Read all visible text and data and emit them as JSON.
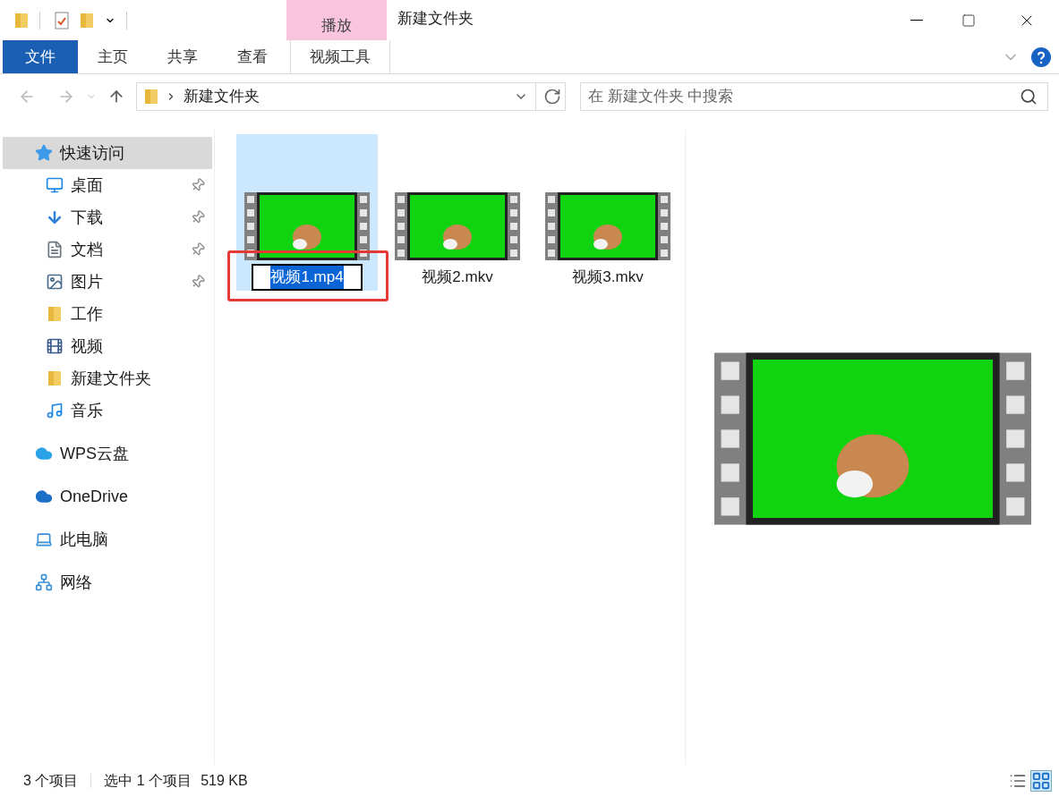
{
  "title_bar": {
    "contextual_tab": "播放",
    "title": "新建文件夹"
  },
  "ribbon_tabs": [
    {
      "label": "文件",
      "kind": "file"
    },
    {
      "label": "主页",
      "kind": "tab"
    },
    {
      "label": "共享",
      "kind": "tab"
    },
    {
      "label": "查看",
      "kind": "tab"
    },
    {
      "label": "视频工具",
      "kind": "contextual"
    }
  ],
  "address_bar": {
    "path": [
      "新建文件夹"
    ]
  },
  "search": {
    "placeholder": "在 新建文件夹 中搜索"
  },
  "sidebar": {
    "items": [
      {
        "label": "快速访问",
        "kind": "star",
        "selected": true,
        "children": [
          {
            "label": "桌面",
            "kind": "desktop",
            "pinned": true,
            "selected": false
          },
          {
            "label": "下载",
            "kind": "download",
            "pinned": true,
            "selected": false
          },
          {
            "label": "文档",
            "kind": "document",
            "pinned": true,
            "selected": false
          },
          {
            "label": "图片",
            "kind": "picture",
            "pinned": true,
            "selected": false
          },
          {
            "label": "工作",
            "kind": "folder",
            "pinned": false,
            "selected": false
          },
          {
            "label": "视频",
            "kind": "video",
            "pinned": false,
            "selected": false
          },
          {
            "label": "新建文件夹",
            "kind": "folder",
            "pinned": false,
            "selected": false
          },
          {
            "label": "音乐",
            "kind": "music",
            "pinned": false,
            "selected": false
          }
        ]
      },
      {
        "label": "WPS云盘",
        "kind": "cloud",
        "selected": false
      },
      {
        "label": "OneDrive",
        "kind": "onedrive",
        "selected": false
      },
      {
        "label": "此电脑",
        "kind": "pc",
        "selected": false
      },
      {
        "label": "网络",
        "kind": "network",
        "selected": false
      }
    ]
  },
  "files": [
    {
      "name": "视频1.mp4",
      "selected": true,
      "renaming": true,
      "highlighted": true
    },
    {
      "name": "视频2.mkv",
      "selected": false,
      "renaming": false,
      "highlighted": false
    },
    {
      "name": "视频3.mkv",
      "selected": false,
      "renaming": false,
      "highlighted": false
    }
  ],
  "status_bar": {
    "item_count": "3 个项目",
    "selection": "选中 1 个项目",
    "size": "519 KB"
  }
}
